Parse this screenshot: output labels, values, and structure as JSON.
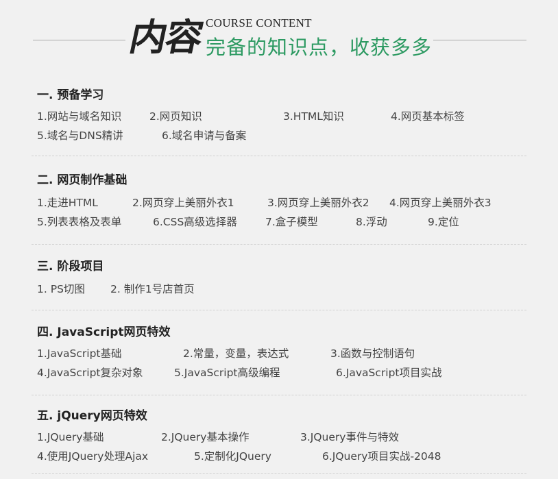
{
  "header": {
    "calligraphy": "内容",
    "english": "COURSE CONTENT",
    "subtitle": "完备的知识点，收获多多"
  },
  "sections": [
    {
      "title": "一. 预备学习",
      "rows": [
        [
          "1.网站与域名知识",
          "2.网页知识",
          "3.HTML知识",
          "4.网页基本标签"
        ],
        [
          "5.域名与DNS精讲",
          "6.域名申请与备案"
        ]
      ]
    },
    {
      "title": "二. 网页制作基础",
      "rows": [
        [
          "1.走进HTML",
          "2.网页穿上美丽外衣1",
          "3.网页穿上美丽外衣2",
          "4.网页穿上美丽外衣3"
        ],
        [
          "5.列表表格及表单",
          "6.CSS高级选择器",
          "7.盒子模型",
          "8.浮动",
          "9.定位"
        ]
      ]
    },
    {
      "title": "三. 阶段项目",
      "rows": [
        [
          "1. PS切图",
          "2. 制作1号店首页"
        ]
      ]
    },
    {
      "title": "四. JavaScript网页特效",
      "rows": [
        [
          "1.JavaScript基础",
          "2.常量，变量，表达式",
          "3.函数与控制语句"
        ],
        [
          "4.JavaScript复杂对象",
          "5.JavaScript高级编程",
          "6.JavaScript项目实战"
        ]
      ]
    },
    {
      "title": "五. jQuery网页特效",
      "rows": [
        [
          "1.JQuery基础",
          "2.JQuery基本操作",
          "3.JQuery事件与特效"
        ],
        [
          "4.使用JQuery处理Ajax",
          "5.定制化JQuery",
          "6.JQuery项目实战-2048"
        ]
      ]
    }
  ]
}
